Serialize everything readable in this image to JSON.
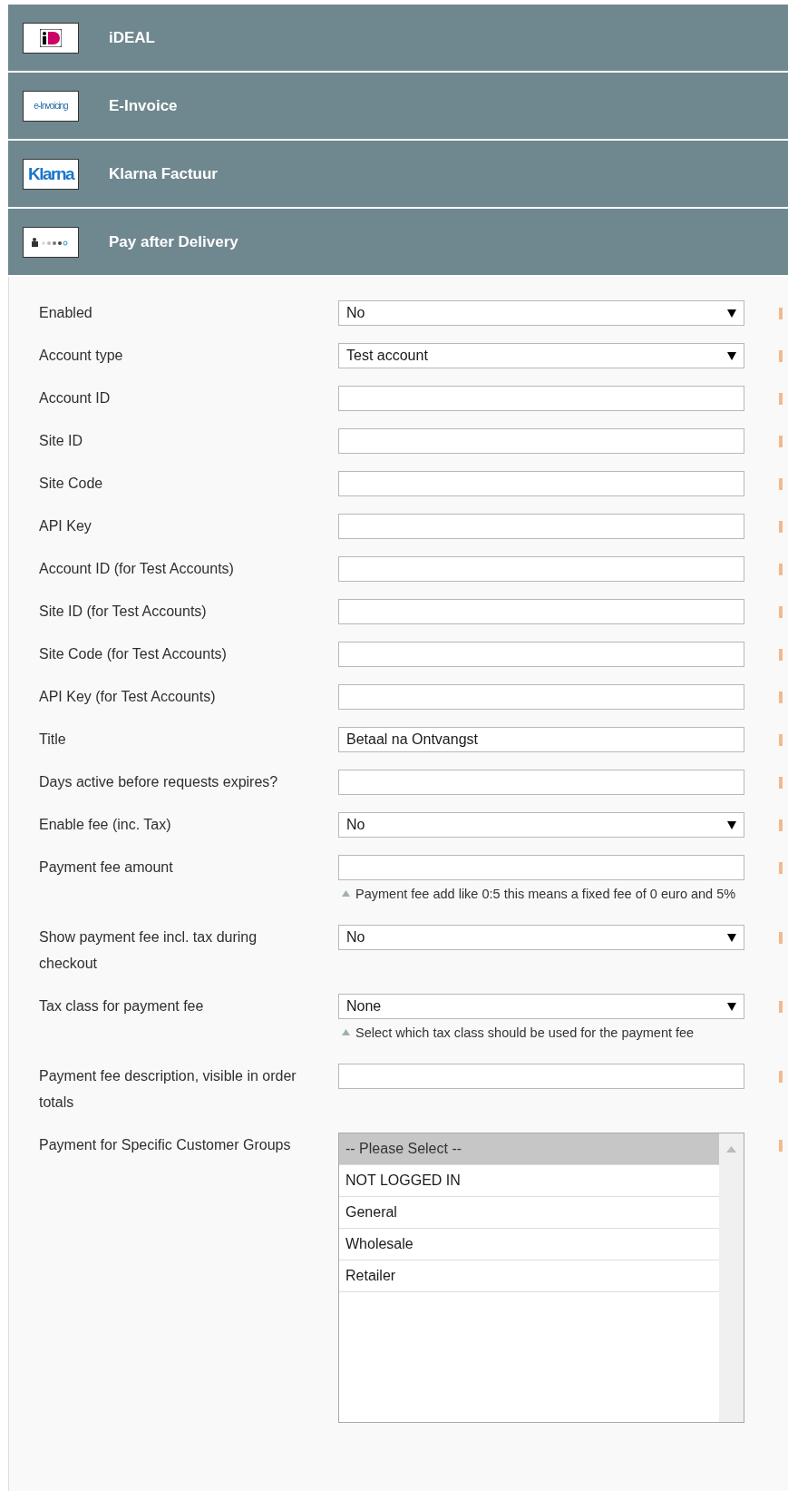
{
  "sections": [
    {
      "title": "iDEAL",
      "kind": "ideal"
    },
    {
      "title": "E-Invoice",
      "kind": "einvoice",
      "logo_text": "e-Invoicing"
    },
    {
      "title": "Klarna Factuur",
      "kind": "klarna",
      "logo_text": "Klarna"
    },
    {
      "title": "Pay after Delivery",
      "kind": "pad"
    }
  ],
  "fields": [
    {
      "label": "Enabled",
      "kind": "select",
      "value": "No"
    },
    {
      "label": "Account type",
      "kind": "select",
      "value": "Test account"
    },
    {
      "label": "Account ID",
      "kind": "text"
    },
    {
      "label": "Site ID",
      "kind": "text"
    },
    {
      "label": "Site Code",
      "kind": "text"
    },
    {
      "label": "API Key",
      "kind": "text"
    },
    {
      "label": "Account ID (for Test Accounts)",
      "kind": "text"
    },
    {
      "label": "Site ID (for Test Accounts)",
      "kind": "text"
    },
    {
      "label": "Site Code (for Test Accounts)",
      "kind": "text"
    },
    {
      "label": "API Key (for Test Accounts)",
      "kind": "text"
    },
    {
      "label": "Title",
      "kind": "text",
      "value": "Betaal na Ontvangst"
    },
    {
      "label": "Days active before requests expires?",
      "kind": "text"
    },
    {
      "label": "Enable fee (inc. Tax)",
      "kind": "select",
      "value": "No"
    },
    {
      "label": "Payment fee amount",
      "kind": "text",
      "note": "Payment fee add like 0:5 this means a fixed fee of 0 euro and 5%"
    },
    {
      "label": "Show payment fee incl. tax during checkout",
      "kind": "select",
      "value": "No"
    },
    {
      "label": "Tax class for payment fee",
      "kind": "select",
      "value": "None",
      "note": "Select which tax class should be used for the payment fee"
    },
    {
      "label": "Payment fee description, visible in order totals",
      "kind": "text"
    },
    {
      "label": "Payment for Specific Customer Groups",
      "kind": "multiselect",
      "options": [
        {
          "label": "-- Please Select --",
          "selected": true
        },
        {
          "label": "NOT LOGGED IN",
          "selected": false
        },
        {
          "label": "General",
          "selected": false
        },
        {
          "label": "Wholesale",
          "selected": false
        },
        {
          "label": "Retailer",
          "selected": false
        }
      ]
    }
  ]
}
